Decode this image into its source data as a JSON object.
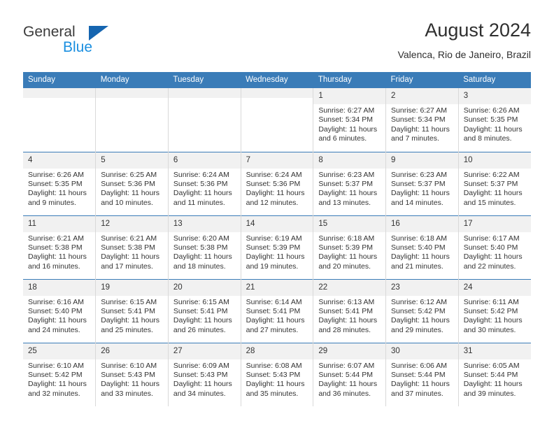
{
  "brand": {
    "name_part1": "General",
    "name_part2": "Blue",
    "triangle_icon": "triangle-icon",
    "accent_blue": "#1a8fe0",
    "logo_triangle_blue": "#1565b0"
  },
  "header": {
    "title": "August 2024",
    "subtitle": "Valenca, Rio de Janeiro, Brazil"
  },
  "theme": {
    "header_row_background": "#3a7cb8",
    "header_row_text": "#ffffff",
    "daynum_strip_background": "#f1f1f1",
    "cell_text": "#333333",
    "row_divider": "#3a7cb8",
    "column_divider": "#d9d9d9"
  },
  "weekdays": [
    "Sunday",
    "Monday",
    "Tuesday",
    "Wednesday",
    "Thursday",
    "Friday",
    "Saturday"
  ],
  "weeks": [
    [
      {
        "day": "",
        "lines": []
      },
      {
        "day": "",
        "lines": []
      },
      {
        "day": "",
        "lines": []
      },
      {
        "day": "",
        "lines": []
      },
      {
        "day": "1",
        "lines": [
          "Sunrise: 6:27 AM",
          "Sunset: 5:34 PM",
          "Daylight: 11 hours",
          "and 6 minutes."
        ]
      },
      {
        "day": "2",
        "lines": [
          "Sunrise: 6:27 AM",
          "Sunset: 5:34 PM",
          "Daylight: 11 hours",
          "and 7 minutes."
        ]
      },
      {
        "day": "3",
        "lines": [
          "Sunrise: 6:26 AM",
          "Sunset: 5:35 PM",
          "Daylight: 11 hours",
          "and 8 minutes."
        ]
      }
    ],
    [
      {
        "day": "4",
        "lines": [
          "Sunrise: 6:26 AM",
          "Sunset: 5:35 PM",
          "Daylight: 11 hours",
          "and 9 minutes."
        ]
      },
      {
        "day": "5",
        "lines": [
          "Sunrise: 6:25 AM",
          "Sunset: 5:36 PM",
          "Daylight: 11 hours",
          "and 10 minutes."
        ]
      },
      {
        "day": "6",
        "lines": [
          "Sunrise: 6:24 AM",
          "Sunset: 5:36 PM",
          "Daylight: 11 hours",
          "and 11 minutes."
        ]
      },
      {
        "day": "7",
        "lines": [
          "Sunrise: 6:24 AM",
          "Sunset: 5:36 PM",
          "Daylight: 11 hours",
          "and 12 minutes."
        ]
      },
      {
        "day": "8",
        "lines": [
          "Sunrise: 6:23 AM",
          "Sunset: 5:37 PM",
          "Daylight: 11 hours",
          "and 13 minutes."
        ]
      },
      {
        "day": "9",
        "lines": [
          "Sunrise: 6:23 AM",
          "Sunset: 5:37 PM",
          "Daylight: 11 hours",
          "and 14 minutes."
        ]
      },
      {
        "day": "10",
        "lines": [
          "Sunrise: 6:22 AM",
          "Sunset: 5:37 PM",
          "Daylight: 11 hours",
          "and 15 minutes."
        ]
      }
    ],
    [
      {
        "day": "11",
        "lines": [
          "Sunrise: 6:21 AM",
          "Sunset: 5:38 PM",
          "Daylight: 11 hours",
          "and 16 minutes."
        ]
      },
      {
        "day": "12",
        "lines": [
          "Sunrise: 6:21 AM",
          "Sunset: 5:38 PM",
          "Daylight: 11 hours",
          "and 17 minutes."
        ]
      },
      {
        "day": "13",
        "lines": [
          "Sunrise: 6:20 AM",
          "Sunset: 5:38 PM",
          "Daylight: 11 hours",
          "and 18 minutes."
        ]
      },
      {
        "day": "14",
        "lines": [
          "Sunrise: 6:19 AM",
          "Sunset: 5:39 PM",
          "Daylight: 11 hours",
          "and 19 minutes."
        ]
      },
      {
        "day": "15",
        "lines": [
          "Sunrise: 6:18 AM",
          "Sunset: 5:39 PM",
          "Daylight: 11 hours",
          "and 20 minutes."
        ]
      },
      {
        "day": "16",
        "lines": [
          "Sunrise: 6:18 AM",
          "Sunset: 5:40 PM",
          "Daylight: 11 hours",
          "and 21 minutes."
        ]
      },
      {
        "day": "17",
        "lines": [
          "Sunrise: 6:17 AM",
          "Sunset: 5:40 PM",
          "Daylight: 11 hours",
          "and 22 minutes."
        ]
      }
    ],
    [
      {
        "day": "18",
        "lines": [
          "Sunrise: 6:16 AM",
          "Sunset: 5:40 PM",
          "Daylight: 11 hours",
          "and 24 minutes."
        ]
      },
      {
        "day": "19",
        "lines": [
          "Sunrise: 6:15 AM",
          "Sunset: 5:41 PM",
          "Daylight: 11 hours",
          "and 25 minutes."
        ]
      },
      {
        "day": "20",
        "lines": [
          "Sunrise: 6:15 AM",
          "Sunset: 5:41 PM",
          "Daylight: 11 hours",
          "and 26 minutes."
        ]
      },
      {
        "day": "21",
        "lines": [
          "Sunrise: 6:14 AM",
          "Sunset: 5:41 PM",
          "Daylight: 11 hours",
          "and 27 minutes."
        ]
      },
      {
        "day": "22",
        "lines": [
          "Sunrise: 6:13 AM",
          "Sunset: 5:41 PM",
          "Daylight: 11 hours",
          "and 28 minutes."
        ]
      },
      {
        "day": "23",
        "lines": [
          "Sunrise: 6:12 AM",
          "Sunset: 5:42 PM",
          "Daylight: 11 hours",
          "and 29 minutes."
        ]
      },
      {
        "day": "24",
        "lines": [
          "Sunrise: 6:11 AM",
          "Sunset: 5:42 PM",
          "Daylight: 11 hours",
          "and 30 minutes."
        ]
      }
    ],
    [
      {
        "day": "25",
        "lines": [
          "Sunrise: 6:10 AM",
          "Sunset: 5:42 PM",
          "Daylight: 11 hours",
          "and 32 minutes."
        ]
      },
      {
        "day": "26",
        "lines": [
          "Sunrise: 6:10 AM",
          "Sunset: 5:43 PM",
          "Daylight: 11 hours",
          "and 33 minutes."
        ]
      },
      {
        "day": "27",
        "lines": [
          "Sunrise: 6:09 AM",
          "Sunset: 5:43 PM",
          "Daylight: 11 hours",
          "and 34 minutes."
        ]
      },
      {
        "day": "28",
        "lines": [
          "Sunrise: 6:08 AM",
          "Sunset: 5:43 PM",
          "Daylight: 11 hours",
          "and 35 minutes."
        ]
      },
      {
        "day": "29",
        "lines": [
          "Sunrise: 6:07 AM",
          "Sunset: 5:44 PM",
          "Daylight: 11 hours",
          "and 36 minutes."
        ]
      },
      {
        "day": "30",
        "lines": [
          "Sunrise: 6:06 AM",
          "Sunset: 5:44 PM",
          "Daylight: 11 hours",
          "and 37 minutes."
        ]
      },
      {
        "day": "31",
        "lines": [
          "Sunrise: 6:05 AM",
          "Sunset: 5:44 PM",
          "Daylight: 11 hours",
          "and 39 minutes."
        ]
      }
    ]
  ]
}
